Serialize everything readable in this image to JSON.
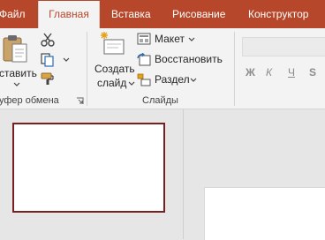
{
  "tabs": [
    {
      "label": "Файл",
      "active": false
    },
    {
      "label": "Главная",
      "active": true
    },
    {
      "label": "Вставка",
      "active": false
    },
    {
      "label": "Рисование",
      "active": false
    },
    {
      "label": "Конструктор",
      "active": false
    }
  ],
  "ribbon": {
    "clipboard": {
      "paste_label": "ставить",
      "group_label": "уфер обмена"
    },
    "slides": {
      "new_slide_line1": "Создать",
      "new_slide_line2": "слайд",
      "layout_label": "Макет",
      "reset_label": "Восстановить",
      "section_label": "Раздел",
      "group_label": "Слайды"
    },
    "font": {
      "bold": "Ж",
      "italic": "К",
      "underline": "Ч",
      "shadow": "S"
    }
  },
  "colors": {
    "accent": "#b7472a",
    "ribbon_bg": "#f3f3f3",
    "workspace_bg": "#e6e6e6",
    "selected_thumb_border": "#7a1f1f"
  }
}
